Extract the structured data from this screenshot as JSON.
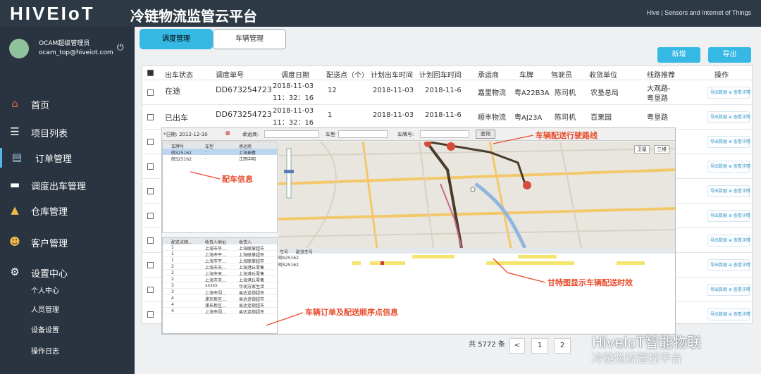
{
  "header": {
    "logo": "HIVEIoT",
    "title": "冷链物流监管云平台",
    "tagline": "Hive | Sensors and Internet of Things"
  },
  "user": {
    "name": "OCAM超级管理员",
    "email": "ocam_top@hiveiot.com"
  },
  "nav": [
    {
      "label": "首页"
    },
    {
      "label": "项目列表"
    },
    {
      "label": "订单管理"
    },
    {
      "label": "调度出车管理"
    },
    {
      "label": "仓库管理"
    },
    {
      "label": "客户管理"
    },
    {
      "label": "设置中心"
    }
  ],
  "subnav": [
    "个人中心",
    "人员管理",
    "设备设置",
    "操作日志"
  ],
  "tabs": [
    "调度管理",
    "车辆管理"
  ],
  "buttons": {
    "add": "新增",
    "export": "导出"
  },
  "table": {
    "headers": [
      "出车状态",
      "调度单号",
      "调度日期",
      "配送点（个）",
      "计划出车时间",
      "计划回车时间",
      "承运商",
      "车牌",
      "驾驶员",
      "收货单位",
      "线路推荐",
      "操作"
    ],
    "rows": [
      {
        "status": "在途",
        "no": "DD673254723",
        "date": "2018-11-03",
        "time": "11：32：16",
        "points": "12",
        "out": "2018-11-03",
        "back": "2018-11-6",
        "carrier": "嘉里物流",
        "plate": "粤A22B3A",
        "driver": "陈司机",
        "receiver": "农垦总局",
        "route1": "大观路-",
        "route2": "粤垦路"
      },
      {
        "status": "已出车",
        "no": "DD673254723",
        "date": "2018-11-03",
        "time": "11：32：16",
        "points": "1",
        "out": "2018-11-03",
        "back": "2018-11-6",
        "carrier": "顺丰物流",
        "plate": "粤AJ23A",
        "driver": "陈司机",
        "receiver": "百果园",
        "route1": "粤垦路",
        "route2": ""
      }
    ],
    "action_label": "导出数据 ⊕ 查看详情"
  },
  "overlay": {
    "date_label": "*日期: 2012-12-10",
    "carrier_label": "承运商:",
    "vehicle_label": "车型",
    "plate_label": "车牌号:",
    "query": "查询",
    "veh_headers": [
      "车牌号",
      "车型",
      "承运商"
    ],
    "veh_rows": [
      {
        "plate": "皖S25162",
        "type": "-",
        "carrier": "上海振春"
      },
      {
        "plate": "皖S25162",
        "type": "-",
        "carrier": "江西中昭"
      }
    ],
    "order_headers": [
      "配送点顺…",
      "收货人地址",
      "收货人"
    ],
    "order_rows": [
      [
        "1",
        "上海市平…",
        "上海联掌超市"
      ],
      [
        "1",
        "上海市平…",
        "上海联掌超市"
      ],
      [
        "1",
        "上海市平…",
        "上海联掌超市"
      ],
      [
        "2",
        "上海市天…",
        "上海港丘零售"
      ],
      [
        "2",
        "上海市天…",
        "上海港丘零售"
      ],
      [
        "2",
        "上海市天…",
        "上海港丘零售"
      ],
      [
        "3",
        "xxxxx",
        "华润万家生活"
      ],
      [
        "3",
        "上海市闵…",
        "易达连锁超市"
      ],
      [
        "4",
        "浦东新区…",
        "易达连锁超市"
      ],
      [
        "4",
        "浦东新区…",
        "易达连锁超市"
      ],
      [
        "4",
        "上海市闵…",
        "易达连锁超市"
      ]
    ],
    "gantt_headers": [
      "车号",
      "配送车号"
    ],
    "gantt_rows": [
      "皖S25162",
      "皖S25162"
    ],
    "map_buttons": [
      "卫星",
      "三维"
    ],
    "annotations": {
      "vehicle_info": "配车信息",
      "route": "车辆配送行驶路线",
      "gantt": "甘特图显示车辆配送时效",
      "orders": "车辆订单及配送顺序点信息"
    }
  },
  "pager": {
    "total": "共 5772 条",
    "prev": "<",
    "page1": "1",
    "page2": "2"
  },
  "watermark": {
    "line1": "HiveIoT智能物联",
    "line2": "冷链物流管控平台"
  },
  "colors": {
    "topbar": "#2d3a45",
    "sidebar": "#2a3440",
    "accent": "#35b8e4",
    "annotation": "#e84b2b"
  }
}
